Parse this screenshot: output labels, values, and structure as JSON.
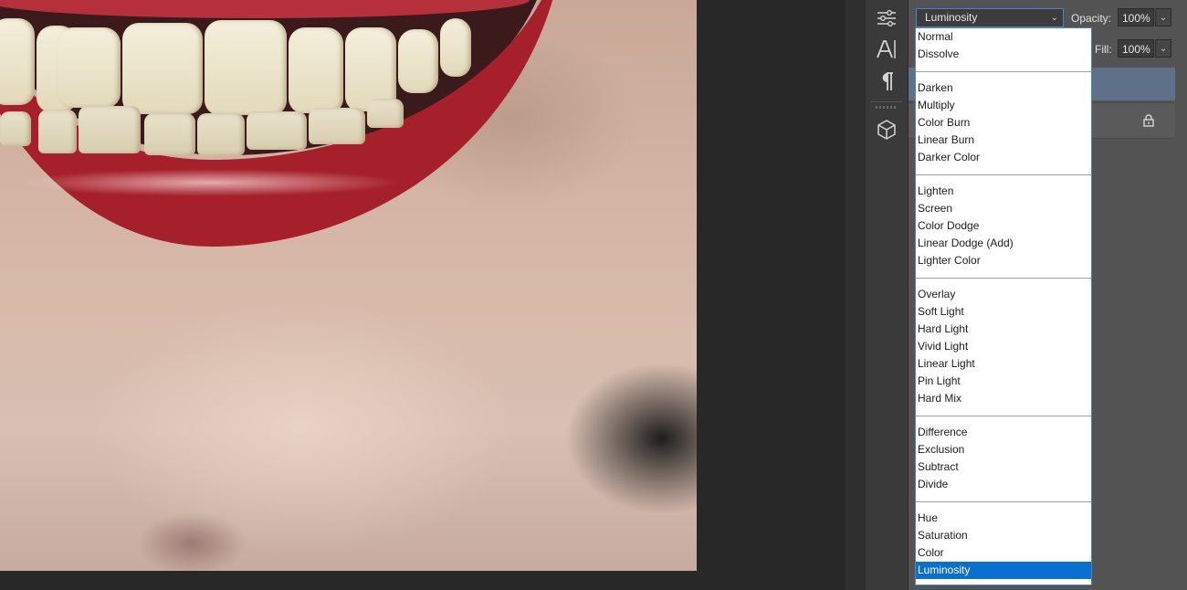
{
  "layers_panel": {
    "blend_mode": "Luminosity",
    "opacity_label": "Opacity:",
    "opacity_value": "100%",
    "fill_label": "Fill:",
    "fill_value": "100%"
  },
  "blend_modes_dropdown": {
    "groups": [
      [
        "Normal",
        "Dissolve"
      ],
      [
        "Darken",
        "Multiply",
        "Color Burn",
        "Linear Burn",
        "Darker Color"
      ],
      [
        "Lighten",
        "Screen",
        "Color Dodge",
        "Linear Dodge (Add)",
        "Lighter Color"
      ],
      [
        "Overlay",
        "Soft Light",
        "Hard Light",
        "Vivid Light",
        "Linear Light",
        "Pin Light",
        "Hard Mix"
      ],
      [
        "Difference",
        "Exclusion",
        "Subtract",
        "Divide"
      ],
      [
        "Hue",
        "Saturation",
        "Color",
        "Luminosity"
      ]
    ],
    "selected": "Luminosity"
  },
  "tool_strip": {
    "icons": [
      "adjustments-icon",
      "character-icon",
      "paragraph-icon",
      "3d-cube-icon"
    ]
  },
  "colors": {
    "selection_blue": "#0a6fd1",
    "focus_border": "#4d82c8",
    "selected_layer": "#5f7189",
    "panel_bg": "#535353"
  }
}
